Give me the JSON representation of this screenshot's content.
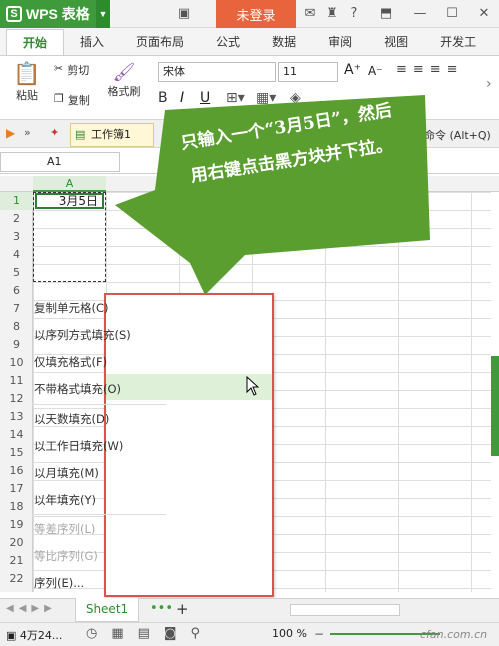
{
  "app": {
    "name": "WPS 表格",
    "login": "未登录"
  },
  "tabs": [
    "开始",
    "插入",
    "页面布局",
    "公式",
    "数据",
    "审阅",
    "视图",
    "开发工"
  ],
  "ribbon": {
    "paste": "粘贴",
    "cut": "剪切",
    "copy": "复制",
    "format_painter": "格式刷",
    "font_name": "宋体",
    "font_size": "11"
  },
  "quickbar": {
    "doc_tab": "工作簿1",
    "command_hint": "命令 (Alt+Q)"
  },
  "formula_bar": {
    "cell_ref": "A1"
  },
  "grid": {
    "column_a": "A",
    "rows": [
      "1",
      "2",
      "3",
      "4",
      "5",
      "6",
      "7",
      "8",
      "9",
      "10",
      "11",
      "12",
      "13",
      "14",
      "15",
      "16",
      "17",
      "18",
      "19",
      "20",
      "21",
      "22"
    ],
    "cell_a1": "3月5日"
  },
  "context_menu": {
    "items": [
      "复制单元格(C)",
      "以序列方式填充(S)",
      "仅填充格式(F)",
      "不带格式填充(O)",
      "以天数填充(D)",
      "以工作日填充(W)",
      "以月填充(M)",
      "以年填充(Y)",
      "等差序列(L)",
      "等比序列(G)",
      "序列(E)..."
    ]
  },
  "callout": {
    "text": "只输入一个“3月5日”，然后用右键点击黑方块并下拉。"
  },
  "sheets": {
    "active": "Sheet1"
  },
  "status": {
    "summary": "4万24...",
    "zoom": "100 %"
  },
  "watermark": "cfan.com.cn"
}
